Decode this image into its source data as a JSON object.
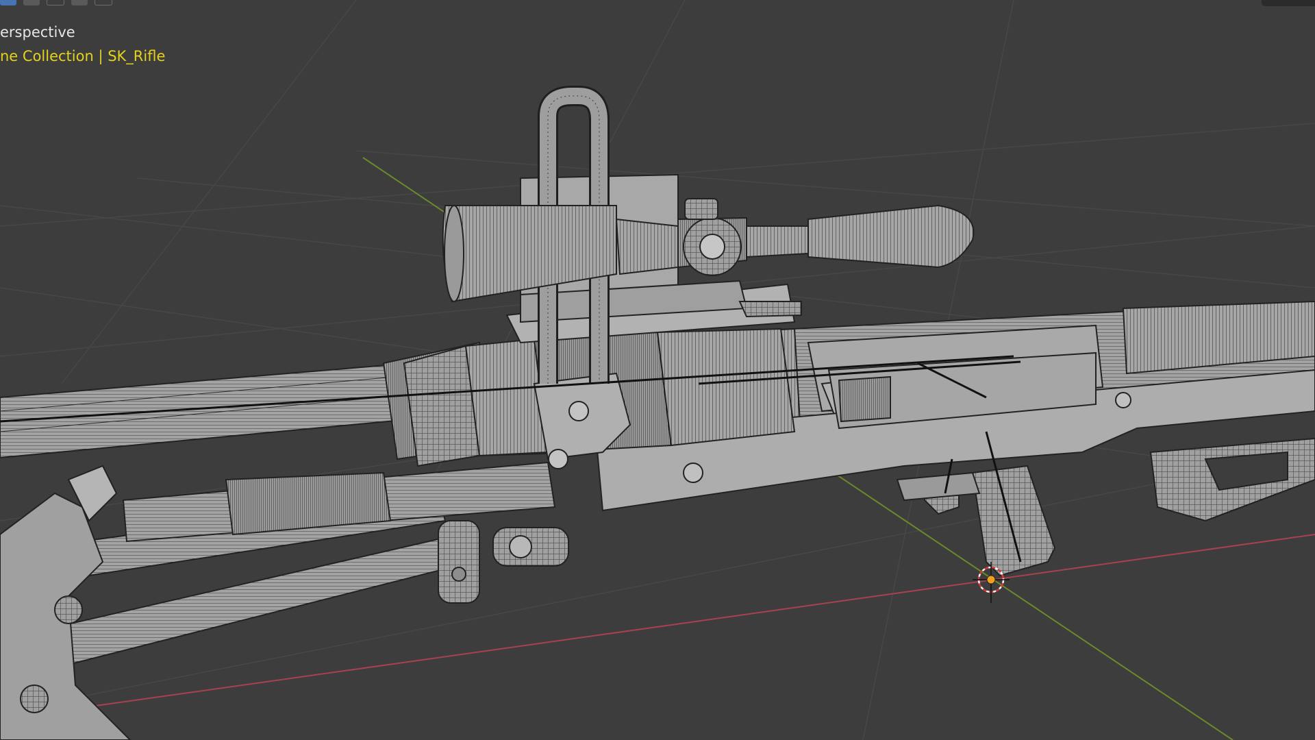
{
  "viewport": {
    "view_label": "erspective",
    "collection_label": "ne Collection | SK_Rifle"
  },
  "toolbar": {
    "buttons": [
      "select-box-icon",
      "select-box-icon",
      "select-extend-icon",
      "select-subtract-icon",
      "select-intersect-icon"
    ]
  },
  "theme": {
    "background": "#3d3d3d",
    "grid": "#474747",
    "x_axis": "#a8424f",
    "y_axis": "#6b8b2a",
    "collection_text": "#e4d21d",
    "view_text": "#e6e6e6",
    "origin": "#f0a020"
  },
  "scene": {
    "object": "rifle-mesh",
    "shading": "wireframe-overlay"
  }
}
